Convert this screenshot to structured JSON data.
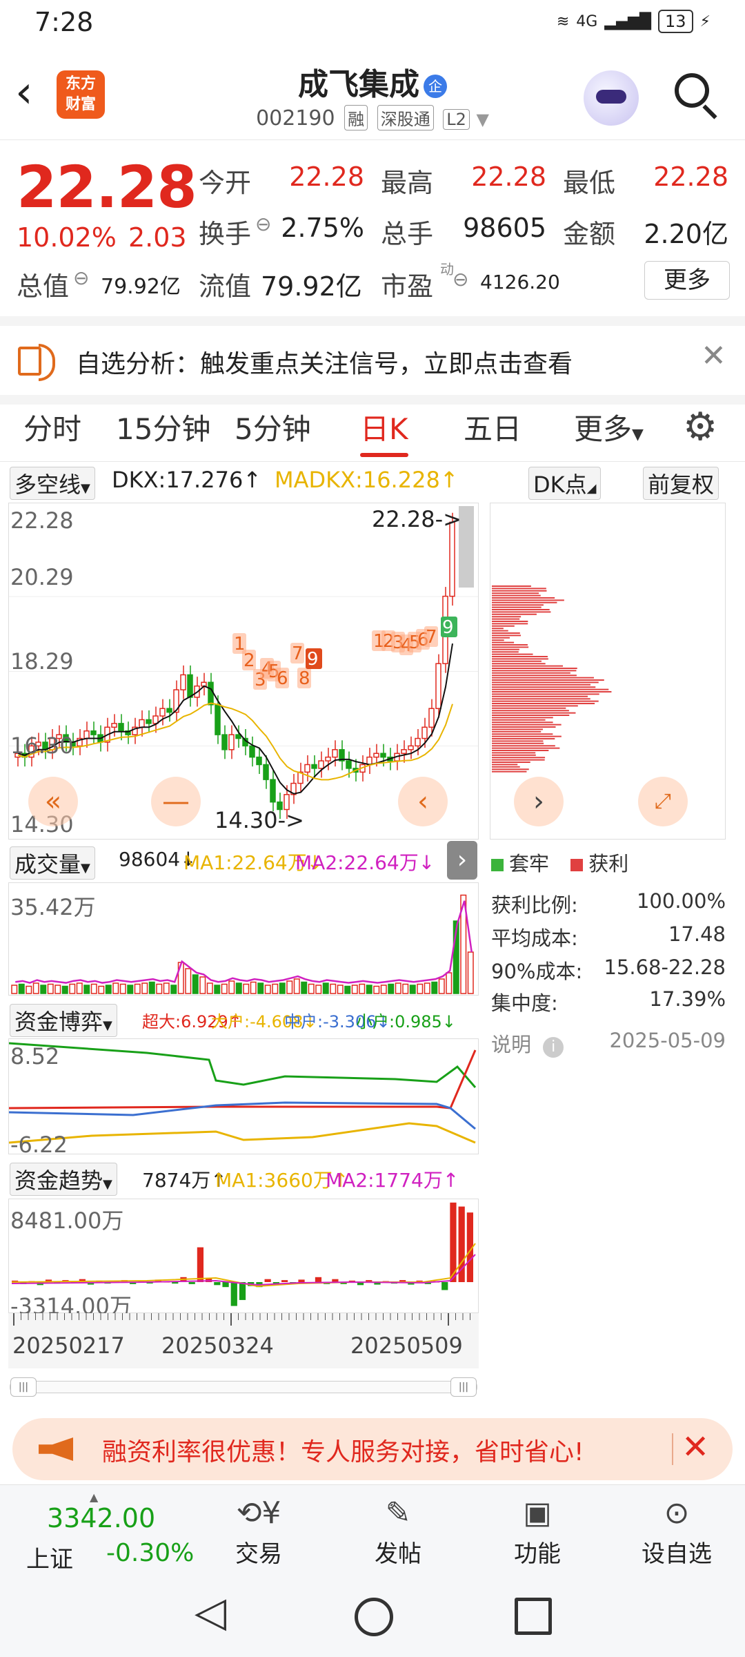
{
  "status": {
    "time": "7:28",
    "signal": "4G",
    "battery": "13"
  },
  "header": {
    "back": "‹",
    "logo_line1": "东方",
    "logo_line2": "财富",
    "title": "成飞集成",
    "title_badge": "企",
    "code": "002190",
    "tags": [
      "融",
      "深股通",
      "L2"
    ]
  },
  "quote": {
    "price": "22.28",
    "pct": "10.02%",
    "change": "2.03",
    "rows": [
      [
        {
          "label": "今开",
          "value": "22.28",
          "color": "red"
        },
        {
          "label": "最高",
          "value": "22.28",
          "color": "red"
        },
        {
          "label": "最低",
          "value": "22.28",
          "color": "red"
        }
      ],
      [
        {
          "label": "换手",
          "value": "2.75%",
          "color": "dark"
        },
        {
          "label": "总手",
          "value": "98605",
          "color": "dark"
        },
        {
          "label": "金额",
          "value": "2.20亿",
          "color": "dark"
        }
      ]
    ],
    "total_value_label": "总值",
    "total_value": "79.92亿",
    "float_value_label": "流值",
    "float_value": "79.92亿",
    "pe_label": "市盈",
    "pe_sup": "动",
    "pe_value": "4126.20",
    "more": "更多"
  },
  "notice": {
    "text": "自选分析：触发重点关注信号，立即点击查看",
    "close": "✕"
  },
  "tabs": {
    "items": [
      "分时",
      "15分钟",
      "5分钟",
      "日K",
      "五日",
      "更多"
    ],
    "active": "日K"
  },
  "kline": {
    "indicator_select": "多空线",
    "dkx": "DKX:17.276↑",
    "madkx": "MADKX:16.228↑",
    "dk_button": "DK点",
    "adjust_button": "前复权",
    "price_labels": [
      "22.28",
      "20.29",
      "18.29",
      "16.30",
      "14.30"
    ],
    "high_marker": "22.28->",
    "low_marker": "14.30->",
    "signal_9": "9",
    "td_labels": [
      "1",
      "2",
      "3",
      "4",
      "5",
      "6",
      "7",
      "8",
      "9",
      "1",
      "2",
      "3",
      "4",
      "5",
      "6",
      "7",
      "9"
    ]
  },
  "chip": {
    "legend_trap": "套牢",
    "legend_profit": "获利",
    "stats": [
      {
        "label": "获利比例:",
        "value": "100.00%"
      },
      {
        "label": "平均成本:",
        "value": "17.48"
      },
      {
        "label": "90%成本:",
        "value": "15.68-22.28"
      },
      {
        "label": "集中度:",
        "value": "17.39%"
      }
    ],
    "note": "说明",
    "date": "2025-05-09"
  },
  "volume": {
    "select": "成交量",
    "value": "98604↓",
    "ma1": "MA1:22.64万↓",
    "ma2": "MA2:22.64万↓",
    "top_label": "35.42万"
  },
  "capital_game": {
    "select": "资金博弈",
    "super": "超大:6.929↑",
    "big": "大户:-4.608↓",
    "mid": "中户:-3.306↓",
    "small": "小户:0.985↓",
    "top_label": "8.52",
    "bottom_label": "-6.22"
  },
  "capital_trend": {
    "select": "资金趋势",
    "value": "7874万↑",
    "ma1": "MA1:3660万↑",
    "ma2": "MA2:1774万↑",
    "top_label": "8481.00万",
    "bottom_label": "-3314.00万"
  },
  "dates": [
    "20250217",
    "20250324",
    "20250509"
  ],
  "banner": {
    "text": "融资利率很优惠！专人服务对接，省时省心!",
    "close": "✕"
  },
  "bottom_nav": {
    "index_value": "3342.00",
    "index_name": "上证",
    "index_change": "-0.30%",
    "items": [
      "交易",
      "发帖",
      "功能",
      "设自选"
    ]
  },
  "colors": {
    "up": "#e0281e",
    "down": "#18a018",
    "accent": "#ef5a1c",
    "ma_yellow": "#e8b400",
    "ma_magenta": "#d020c0"
  }
}
